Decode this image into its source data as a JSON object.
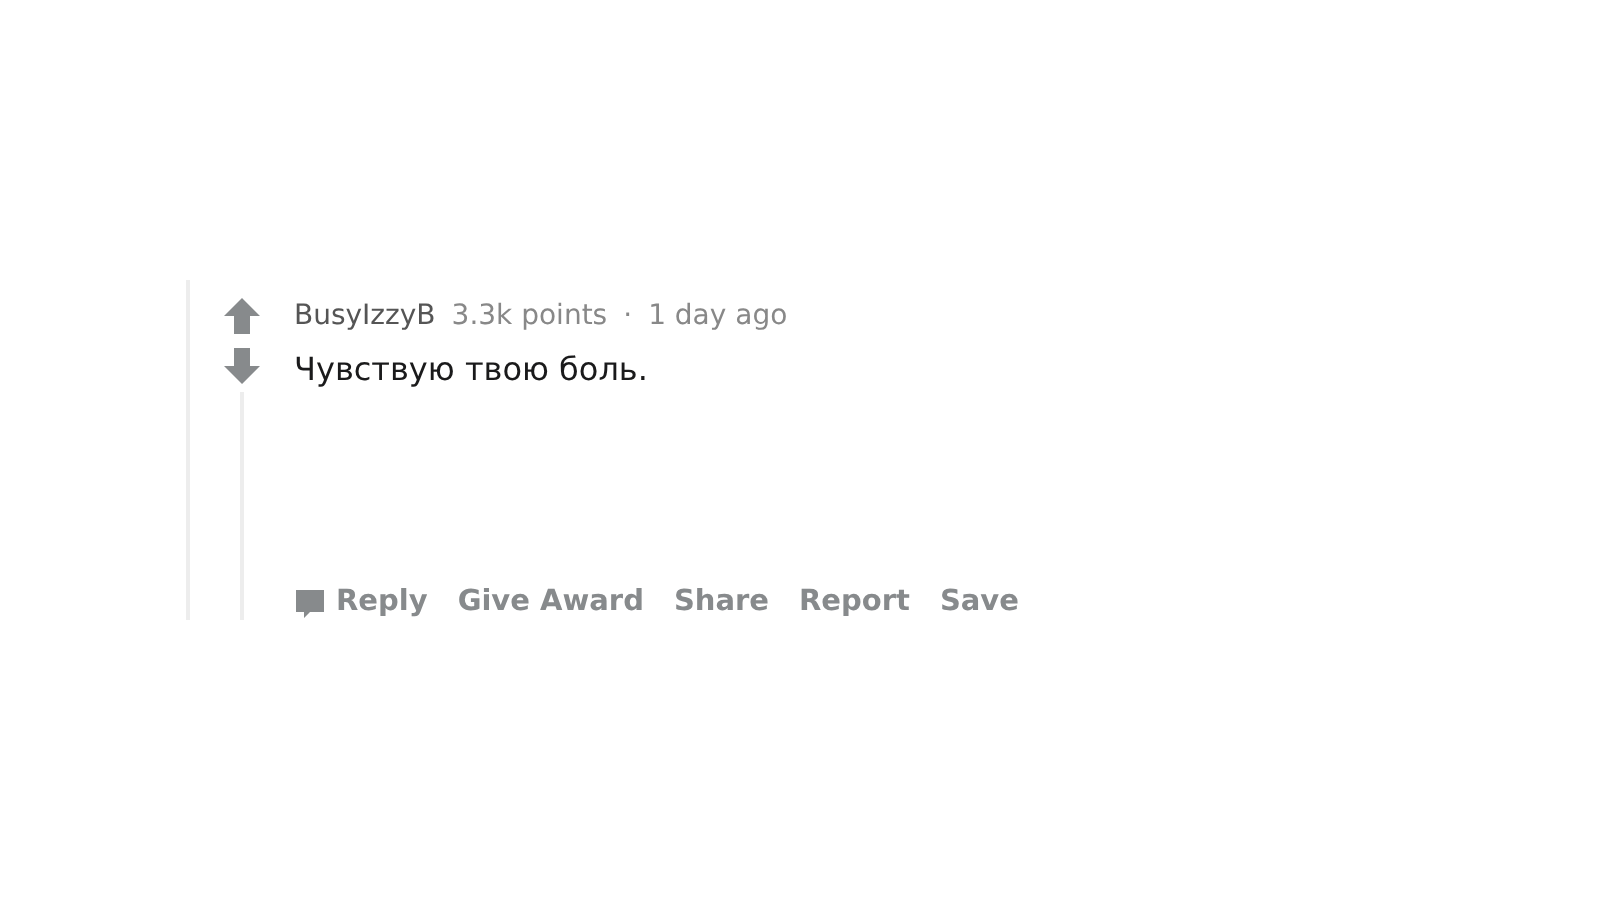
{
  "comment": {
    "author": "BusyIzzyB",
    "score": "3.3k points",
    "separator": "·",
    "time": "1 day ago",
    "body": "Чувствую твою боль.",
    "actions": [
      {
        "label": "Reply",
        "kind": "reply"
      },
      {
        "label": "Give Award",
        "kind": "plain"
      },
      {
        "label": "Share",
        "kind": "plain"
      },
      {
        "label": "Report",
        "kind": "plain"
      },
      {
        "label": "Save",
        "kind": "plain"
      }
    ]
  }
}
